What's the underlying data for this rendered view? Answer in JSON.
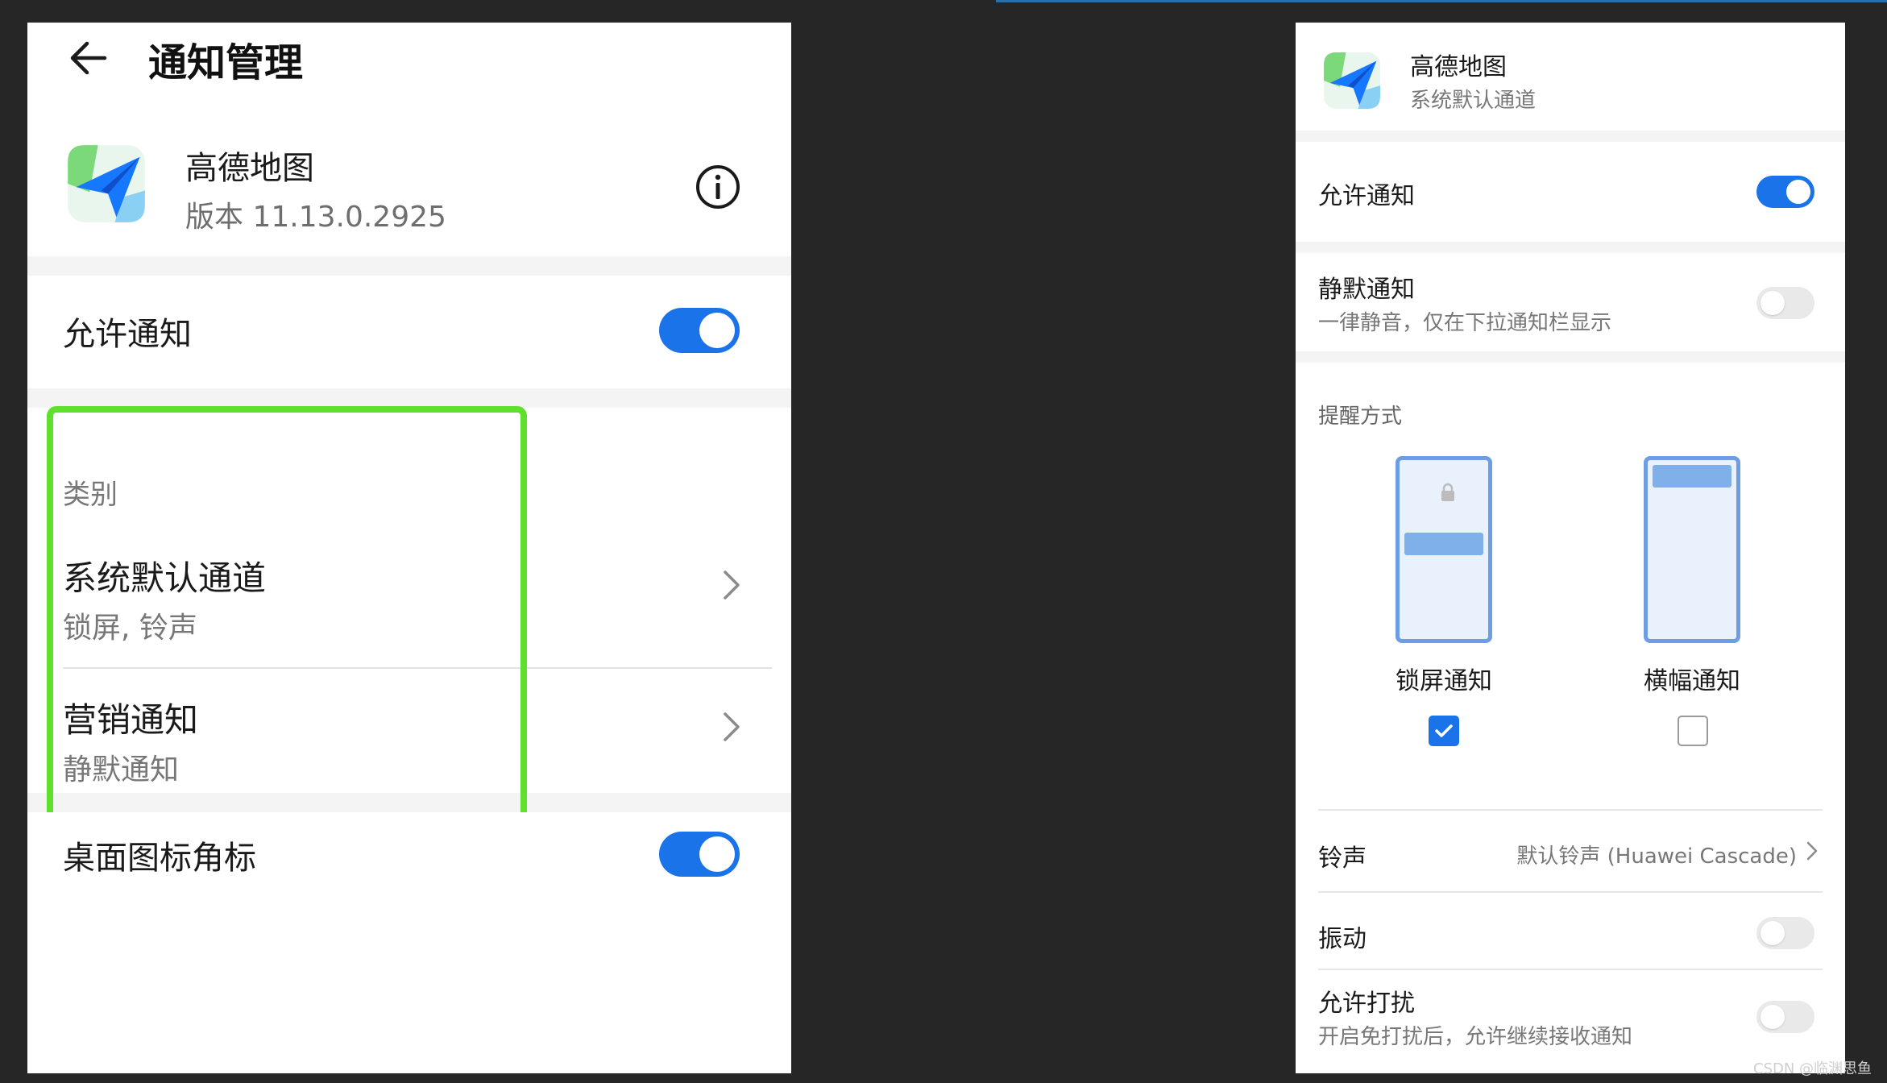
{
  "left": {
    "header": {
      "title": "通知管理"
    },
    "app": {
      "name": "高德地图",
      "version": "版本 11.13.0.2925"
    },
    "allow_notifications": {
      "label": "允许通知",
      "enabled": true
    },
    "categories": {
      "heading": "类别",
      "items": [
        {
          "title": "系统默认通道",
          "subtitle": "锁屏, 铃声"
        },
        {
          "title": "营销通知",
          "subtitle": "静默通知"
        }
      ]
    },
    "badge": {
      "label": "桌面图标角标",
      "enabled": true
    }
  },
  "right": {
    "app": {
      "name": "高德地图",
      "channel": "系统默认通道"
    },
    "allow_notifications": {
      "label": "允许通知",
      "enabled": true
    },
    "silent": {
      "label": "静默通知",
      "subtitle": "一律静音，仅在下拉通知栏显示",
      "enabled": false
    },
    "remind": {
      "heading": "提醒方式",
      "options": [
        {
          "label": "锁屏通知",
          "checked": true
        },
        {
          "label": "横幅通知",
          "checked": false
        }
      ]
    },
    "ringtone": {
      "label": "铃声",
      "value": "默认铃声 (Huawei Cascade)"
    },
    "vibrate": {
      "label": "振动",
      "enabled": false
    },
    "dnd": {
      "label": "允许打扰",
      "subtitle": "开启免打扰后，允许继续接收通知",
      "enabled": false
    }
  },
  "watermark": "CSDN @临渊思鱼",
  "colors": {
    "accent": "#1a73e8",
    "highlight": "#5ee02d",
    "background": "#262626"
  }
}
